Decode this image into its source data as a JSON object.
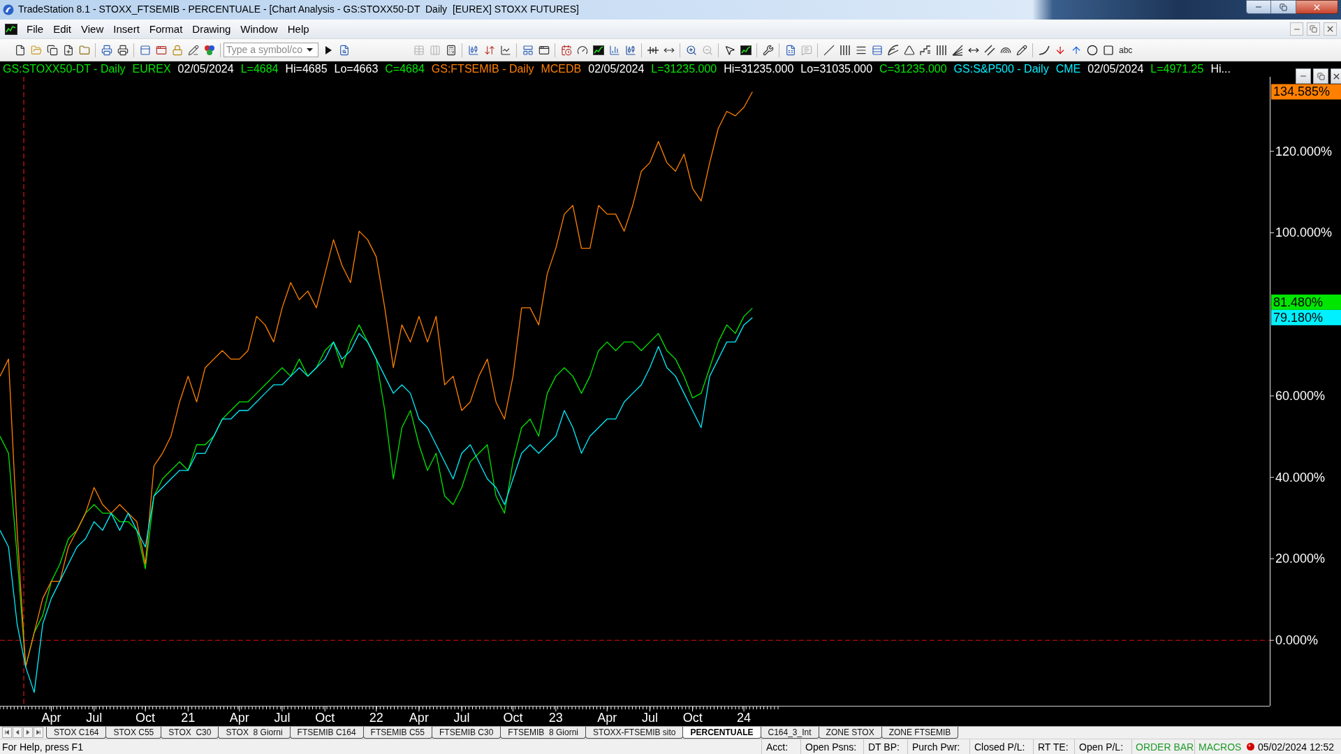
{
  "window": {
    "title": "TradeStation 8.1 - STOXX_FTSEMIB - PERCENTUALE - [Chart Analysis - GS:STOXX50-DT  Daily  [EUREX] STOXX FUTURES]"
  },
  "menu": {
    "items": [
      "File",
      "Edit",
      "View",
      "Insert",
      "Format",
      "Drawing",
      "Window",
      "Help"
    ]
  },
  "toolbar": {
    "buttons": [
      {
        "disabled": false
      },
      {
        "disabled": false
      },
      {
        "disabled": false
      },
      {
        "disabled": false
      },
      {
        "disabled": false
      },
      {
        "disabled": false
      },
      {
        "disabled": false
      },
      {
        "disabled": false
      },
      {
        "disabled": false
      },
      {
        "disabled": false
      },
      {
        "disabled": false
      },
      {
        "disabled": false
      },
      {
        "disabled": false
      },
      {
        "disabled": false
      },
      {
        "disabled": true
      },
      {
        "disabled": true
      },
      {
        "disabled": false
      },
      {
        "disabled": false
      },
      {
        "disabled": false
      },
      {
        "disabled": false
      },
      {
        "disabled": false
      },
      {
        "disabled": false
      },
      {
        "disabled": false
      },
      {
        "disabled": false
      },
      {
        "disabled": false
      },
      {
        "disabled": false
      },
      {
        "disabled": false
      },
      {
        "disabled": false
      },
      {
        "disabled": false
      },
      {
        "disabled": false
      },
      {
        "disabled": true
      },
      {
        "disabled": false
      },
      {
        "disabled": false
      },
      {
        "disabled": false
      },
      {
        "disabled": false
      },
      {
        "disabled": true
      },
      {
        "disabled": false
      },
      {
        "disabled": false
      },
      {
        "disabled": false
      },
      {
        "disabled": false
      },
      {
        "disabled": false
      },
      {
        "disabled": false
      },
      {
        "disabled": false
      },
      {
        "disabled": false
      },
      {
        "disabled": false
      },
      {
        "disabled": false
      },
      {
        "disabled": false
      },
      {
        "disabled": false
      },
      {
        "disabled": false
      },
      {
        "disabled": false
      },
      {
        "disabled": false
      },
      {
        "disabled": false
      },
      {
        "disabled": false
      },
      {
        "disabled": false
      }
    ],
    "symbol_field": {
      "placeholder": "Type a symbol/co"
    },
    "text_tool": "abc"
  },
  "chart": {
    "legend": [
      {
        "exchange": "EUREX",
        "date": "02/05/2024",
        "fields": [
          {
            "kind": "last",
            "text": "L=4684"
          },
          {
            "kind": "high",
            "text": "Hi=4685"
          },
          {
            "kind": "low",
            "text": "Lo=4663"
          },
          {
            "kind": "close",
            "text": "C=4684"
          }
        ]
      },
      {
        "exchange": "MCEDB",
        "date": "02/05/2024",
        "fields": [
          {
            "kind": "last",
            "text": "L=31235.000"
          },
          {
            "kind": "high",
            "text": "Hi=31235.000"
          },
          {
            "kind": "low",
            "text": "Lo=31035.000"
          },
          {
            "kind": "close",
            "text": "C=31235.000"
          }
        ]
      },
      {
        "exchange": "CME",
        "date": "02/05/2024",
        "fields": [
          {
            "kind": "last",
            "text": "L=4971.25"
          },
          {
            "kind": "high",
            "text": "Hi..."
          }
        ]
      }
    ],
    "value_markers": [
      {
        "label": "134.585%",
        "color": "#ff8000"
      },
      {
        "label": "81.480%",
        "color": "#00e600"
      },
      {
        "label": "79.180%",
        "color": "#00f0ff"
      }
    ],
    "chart_data": {
      "type": "line",
      "categories": [
        null,
        null,
        null,
        null,
        null,
        null,
        "Apr",
        null,
        null,
        null,
        null,
        "Jul",
        null,
        null,
        null,
        null,
        null,
        "Oct",
        null,
        null,
        null,
        null,
        "21",
        null,
        null,
        null,
        null,
        null,
        "Apr",
        null,
        null,
        null,
        null,
        "Jul",
        null,
        null,
        null,
        null,
        "Oct",
        null,
        null,
        null,
        null,
        null,
        "22",
        null,
        null,
        null,
        null,
        "Apr",
        null,
        null,
        null,
        null,
        "Jul",
        null,
        null,
        null,
        null,
        null,
        "Oct",
        null,
        null,
        null,
        null,
        "23",
        null,
        null,
        null,
        null,
        null,
        "Apr",
        null,
        null,
        null,
        null,
        "Jul",
        null,
        null,
        null,
        null,
        "Oct",
        null,
        null,
        null,
        null,
        null,
        "24",
        null,
        null,
        null,
        null,
        null,
        null,
        null,
        null,
        null,
        null,
        null,
        null,
        null,
        null,
        null,
        null,
        null,
        null,
        null,
        null,
        null,
        null,
        null,
        null,
        null,
        null,
        null,
        null,
        null,
        null,
        null,
        null,
        null,
        null,
        null,
        null,
        null,
        null,
        null,
        null,
        null,
        null,
        null,
        null,
        null,
        null,
        null,
        null,
        null,
        null,
        null,
        null,
        null,
        null,
        null,
        null,
        null,
        null,
        null,
        null,
        null
      ],
      "series": [
        {
          "name": "GS:STOXX50-DT - Daily",
          "color": "#00e600",
          "values": [
            50.1,
            45.9,
            20.8,
            -6.5,
            1.9,
            6.1,
            14.5,
            18.7,
            24.9,
            27.0,
            31.2,
            33.3,
            31.2,
            31.2,
            29.1,
            29.1,
            27.0,
            17.6,
            35.4,
            39.6,
            41.7,
            43.8,
            41.7,
            48.0,
            48.0,
            50.1,
            54.3,
            56.4,
            58.5,
            58.5,
            60.6,
            62.7,
            64.8,
            66.9,
            64.8,
            69.0,
            64.8,
            66.9,
            71.1,
            73.2,
            66.9,
            73.2,
            77.4,
            73.2,
            69.0,
            56.4,
            39.6,
            52.2,
            56.4,
            48.0,
            41.7,
            45.9,
            35.4,
            33.3,
            37.5,
            43.8,
            45.9,
            48.0,
            35.4,
            31.2,
            43.8,
            52.2,
            54.3,
            50.1,
            60.6,
            64.8,
            66.9,
            64.8,
            60.6,
            64.8,
            71.1,
            73.2,
            71.1,
            73.2,
            73.2,
            71.1,
            73.2,
            75.3,
            71.1,
            69.0,
            64.8,
            59.5,
            60.6,
            66.9,
            73.2,
            77.4,
            75.3,
            79.5,
            81.5,
            null,
            null,
            null,
            null,
            null,
            null,
            null,
            null,
            null,
            null,
            null,
            null,
            null,
            null,
            null,
            null,
            null,
            null,
            null,
            null,
            null,
            null,
            null,
            null,
            null,
            null,
            null,
            null,
            null,
            null,
            null,
            null,
            null,
            null,
            null,
            null,
            null,
            null,
            null,
            null,
            null,
            null,
            null,
            null,
            null,
            null,
            null,
            null,
            null,
            null,
            null,
            null,
            null,
            null,
            null,
            null,
            null,
            null,
            null,
            null
          ]
        },
        {
          "name": "GS:FTSEMIB - Daily",
          "color": "#ff8000",
          "values": [
            64.8,
            69.0,
            27.0,
            -6.5,
            1.9,
            10.3,
            14.5,
            14.5,
            22.9,
            27.0,
            31.2,
            37.5,
            33.3,
            31.2,
            33.3,
            31.2,
            29.1,
            18.7,
            42.8,
            45.9,
            50.1,
            58.5,
            64.8,
            58.5,
            66.9,
            69.0,
            71.1,
            69.0,
            69.0,
            71.1,
            79.5,
            77.4,
            73.2,
            81.6,
            87.8,
            83.6,
            85.7,
            81.6,
            89.9,
            98.3,
            92.0,
            87.8,
            100.4,
            98.3,
            94.1,
            81.6,
            66.9,
            77.4,
            73.2,
            79.5,
            73.2,
            79.5,
            62.7,
            64.8,
            56.4,
            58.5,
            64.8,
            69.0,
            58.5,
            54.3,
            64.8,
            81.6,
            81.6,
            77.4,
            89.9,
            96.2,
            104.6,
            106.7,
            96.2,
            96.2,
            106.7,
            104.6,
            104.6,
            100.4,
            106.7,
            115.1,
            117.2,
            122.4,
            117.2,
            115.1,
            119.3,
            110.9,
            107.8,
            117.2,
            125.6,
            129.8,
            128.7,
            130.8,
            134.6,
            null,
            null,
            null,
            null,
            null,
            null,
            null,
            null,
            null,
            null,
            null,
            null,
            null,
            null,
            null,
            null,
            null,
            null,
            null,
            null,
            null,
            null,
            null,
            null,
            null,
            null,
            null,
            null,
            null,
            null,
            null,
            null,
            null,
            null,
            null,
            null,
            null,
            null,
            null,
            null,
            null,
            null,
            null,
            null,
            null,
            null,
            null,
            null,
            null,
            null,
            null,
            null,
            null,
            null,
            null,
            null,
            null,
            null,
            null,
            null
          ]
        },
        {
          "name": "GS:S&P500 - Daily",
          "color": "#00f0ff",
          "values": [
            27.0,
            22.9,
            4.0,
            -6.5,
            -12.8,
            4.0,
            10.3,
            14.5,
            18.7,
            22.9,
            24.9,
            29.1,
            27.0,
            31.2,
            27.0,
            31.2,
            27.0,
            22.9,
            35.4,
            37.5,
            39.6,
            41.7,
            41.7,
            45.9,
            45.9,
            50.1,
            54.3,
            54.3,
            56.4,
            56.4,
            58.5,
            60.6,
            62.7,
            62.7,
            64.8,
            66.9,
            64.8,
            66.9,
            69.0,
            73.2,
            69.0,
            71.1,
            75.3,
            73.2,
            69.0,
            64.8,
            60.6,
            62.7,
            60.6,
            54.3,
            52.2,
            48.0,
            43.8,
            39.6,
            45.9,
            48.0,
            43.8,
            39.6,
            37.5,
            33.3,
            39.6,
            45.9,
            48.0,
            45.9,
            48.0,
            50.1,
            56.4,
            52.2,
            45.9,
            50.1,
            52.2,
            54.3,
            54.3,
            58.5,
            60.6,
            62.7,
            66.9,
            72.1,
            66.9,
            64.8,
            60.6,
            56.4,
            52.2,
            64.8,
            69.0,
            73.2,
            73.2,
            77.4,
            79.2,
            null,
            null,
            null,
            null,
            null,
            null,
            null,
            null,
            null,
            null,
            null,
            null,
            null,
            null,
            null,
            null,
            null,
            null,
            null,
            null,
            null,
            null,
            null,
            null,
            null,
            null,
            null,
            null,
            null,
            null,
            null,
            null,
            null,
            null,
            null,
            null,
            null,
            null,
            null,
            null,
            null,
            null,
            null,
            null,
            null,
            null,
            null,
            null,
            null,
            null,
            null,
            null,
            null,
            null,
            null,
            null,
            null,
            null,
            null,
            null
          ]
        }
      ],
      "ylim": [
        -16.07,
        138.28
      ],
      "yticks": [
        {
          "value": 0,
          "label": "0.000%"
        },
        {
          "value": 20,
          "label": "20.000%"
        },
        {
          "value": 40,
          "label": "40.000%"
        },
        {
          "value": 60,
          "label": "60.000%"
        },
        {
          "value": 100,
          "label": "100.000%"
        },
        {
          "value": 120,
          "label": "120.000%"
        }
      ],
      "ref_lines": [
        {
          "axis": "y",
          "value": 0
        }
      ]
    }
  },
  "sheet_tabs": [
    {
      "label": "STOX C164",
      "selected": false
    },
    {
      "label": "STOX C55",
      "selected": false
    },
    {
      "label": "STOX  C30",
      "selected": false
    },
    {
      "label": "STOX  8 Giorni",
      "selected": false
    },
    {
      "label": "FTSEMIB C164",
      "selected": false
    },
    {
      "label": "FTSEMIB C55",
      "selected": false
    },
    {
      "label": "FTSEMIB C30",
      "selected": false
    },
    {
      "label": "FTSEMIB  8 Giorni",
      "selected": false
    },
    {
      "label": "STOXX-FTSEMIB sito",
      "selected": false
    },
    {
      "label": "PERCENTUALE",
      "selected": true
    },
    {
      "label": "C164_3_Int",
      "selected": false
    },
    {
      "label": "ZONE STOX",
      "selected": false
    },
    {
      "label": "ZONE FTSEMIB",
      "selected": false
    }
  ],
  "status_bar": {
    "help": "For Help, press F1",
    "panes": [
      {
        "kind": "field",
        "label": "Acct:"
      },
      {
        "kind": "field",
        "label": "Open Psns:"
      },
      {
        "kind": "field",
        "label": "DT BP:"
      },
      {
        "kind": "field",
        "label": "Purch Pwr:"
      },
      {
        "kind": "field",
        "label": "Closed P/L:"
      },
      {
        "kind": "field",
        "label": "RT TE:"
      },
      {
        "kind": "field",
        "label": "Open P/L:"
      },
      {
        "kind": "toggle",
        "label": "ORDER BAR"
      },
      {
        "kind": "toggle",
        "label": "MACROS"
      },
      {
        "kind": "clock",
        "label": "05/02/2024 12:52"
      }
    ]
  }
}
